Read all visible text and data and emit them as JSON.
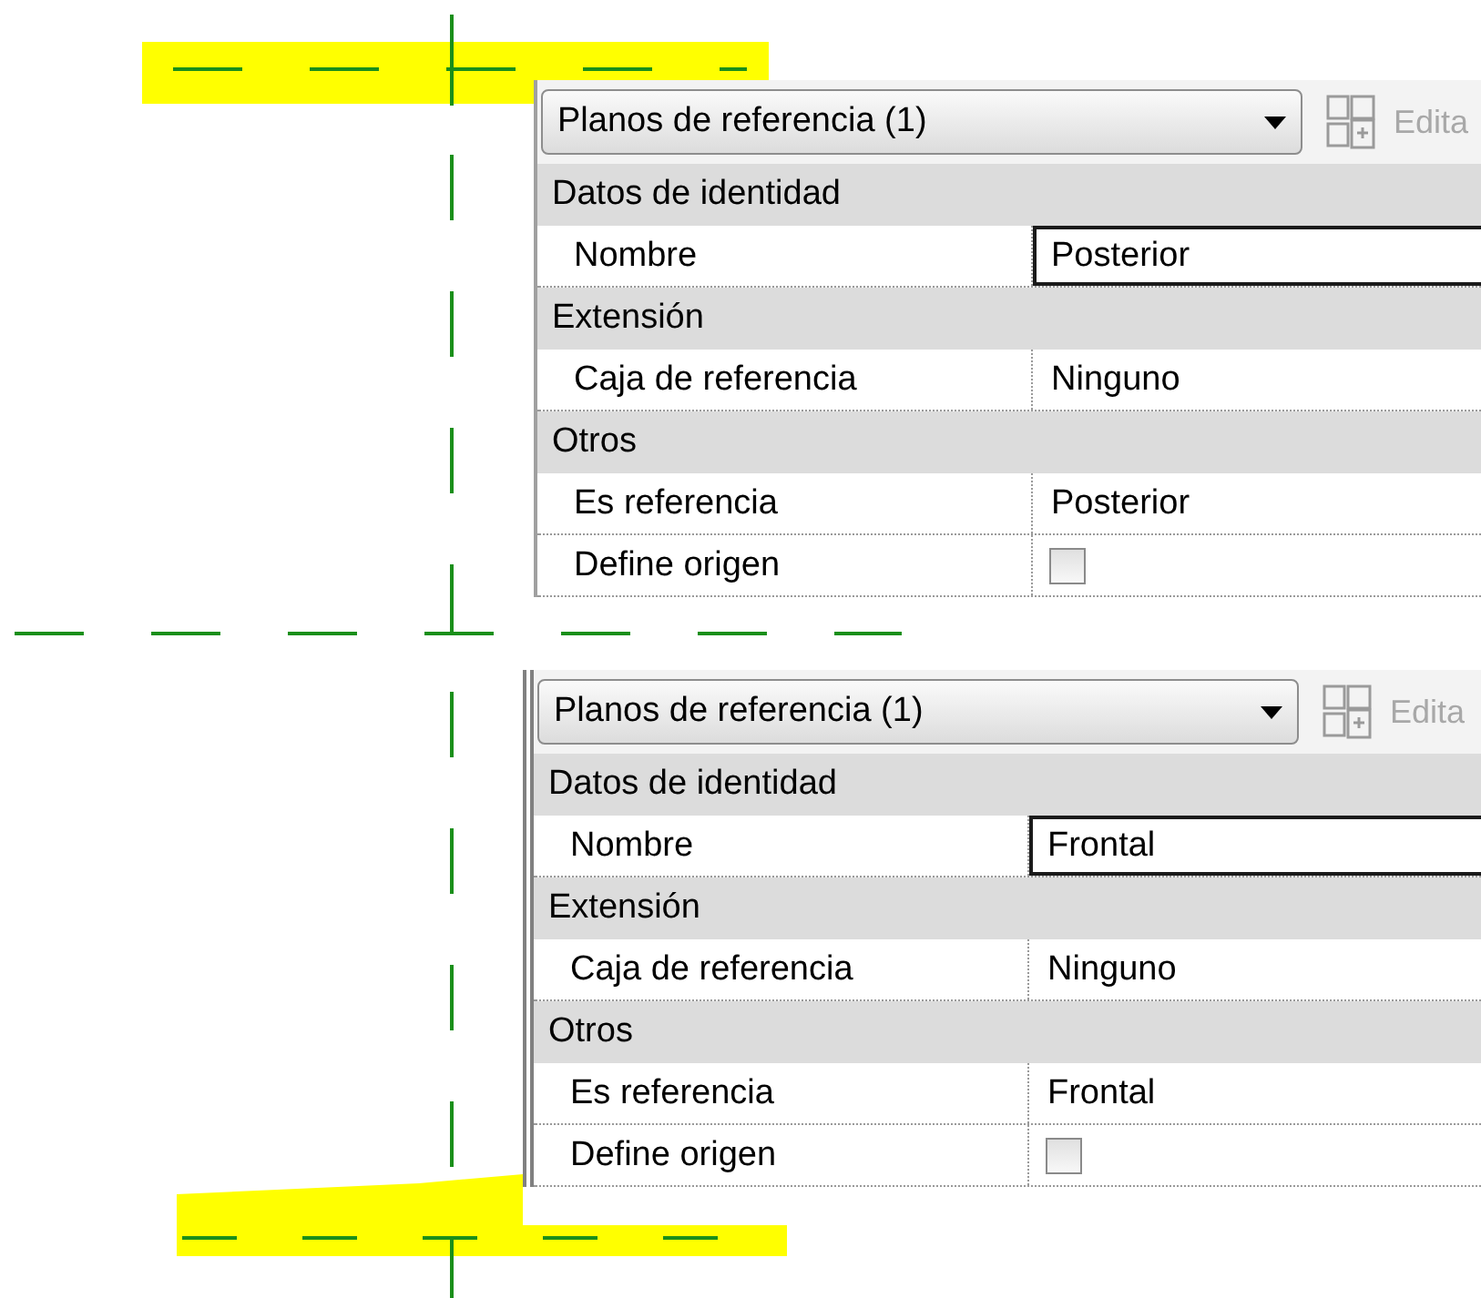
{
  "panels": [
    {
      "type_selector": "Planos de referencia (1)",
      "edit_button": "Edita",
      "sections": [
        {
          "title": "Datos de identidad",
          "rows": [
            {
              "kind": "text",
              "label": "Nombre",
              "value": "Posterior",
              "focused": true
            }
          ]
        },
        {
          "title": "Extensión",
          "rows": [
            {
              "kind": "text",
              "label": "Caja de referencia",
              "value": "Ninguno",
              "focused": false
            }
          ]
        },
        {
          "title": "Otros",
          "rows": [
            {
              "kind": "text",
              "label": "Es referencia",
              "value": "Posterior",
              "focused": false
            },
            {
              "kind": "checkbox",
              "label": "Define origen",
              "checked": false
            }
          ]
        }
      ]
    },
    {
      "type_selector": "Planos de referencia (1)",
      "edit_button": "Edita",
      "sections": [
        {
          "title": "Datos de identidad",
          "rows": [
            {
              "kind": "text",
              "label": "Nombre",
              "value": "Frontal",
              "focused": true
            }
          ]
        },
        {
          "title": "Extensión",
          "rows": [
            {
              "kind": "text",
              "label": "Caja de referencia",
              "value": "Ninguno",
              "focused": false
            }
          ]
        },
        {
          "title": "Otros",
          "rows": [
            {
              "kind": "text",
              "label": "Es referencia",
              "value": "Frontal",
              "focused": false
            },
            {
              "kind": "checkbox",
              "label": "Define origen",
              "checked": false
            }
          ]
        }
      ]
    }
  ]
}
